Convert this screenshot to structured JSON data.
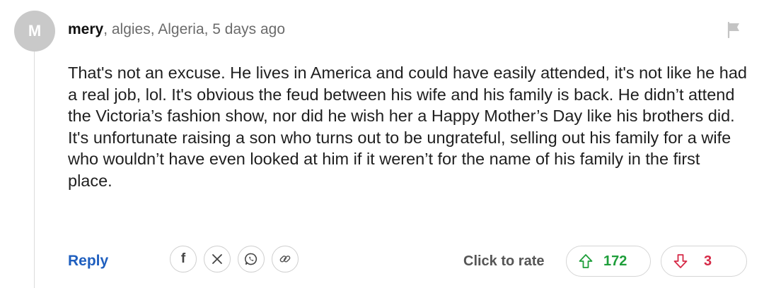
{
  "comment": {
    "avatar_initial": "M",
    "author": "mery",
    "location": ", algies, Algeria, 5 days ago",
    "body": "That's not an excuse. He lives in America and could have easily attended, it's not like he had a real job, lol. It's obvious the feud between his wife and his family is back. He didn’t attend the Victoria’s fashion show, nor did he wish her a Happy Mother’s Day like his brothers did. It's unfortunate raising a son who turns out to be ungrateful, selling out his family for a wife who wouldn’t have even looked at him if it weren’t for the name of his family in the first place."
  },
  "actions": {
    "reply_label": "Reply",
    "share": {
      "facebook_glyph": "f",
      "icons": [
        "facebook-icon",
        "x-icon",
        "whatsapp-icon",
        "link-icon"
      ]
    },
    "rate_label": "Click to rate",
    "upvotes": "172",
    "downvotes": "3"
  },
  "colors": {
    "link": "#1f5fbf",
    "upvote": "#1e9e3a",
    "downvote": "#d62a47",
    "avatar_bg": "#c9c9c9"
  }
}
